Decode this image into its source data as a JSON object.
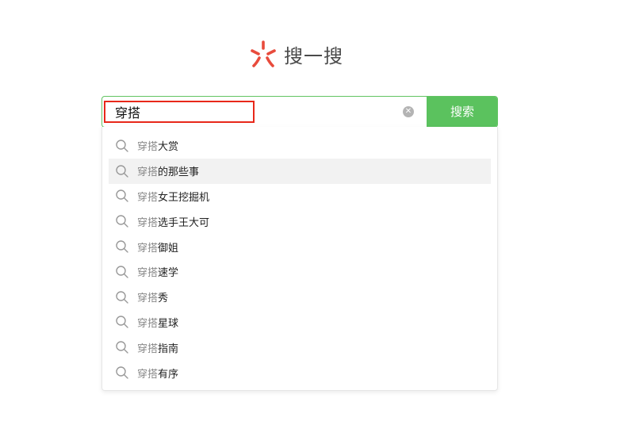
{
  "brand": {
    "title": "搜一搜",
    "logo_icon": "sousou-logo-icon",
    "logo_color": "#e84b3c"
  },
  "search": {
    "query": "穿搭",
    "placeholder": "",
    "clear_icon": "clear-icon",
    "button_label": "搜索",
    "accent_color": "#5bc25e"
  },
  "suggestions": {
    "prefix": "穿搭",
    "active_index": 1,
    "items": [
      {
        "rest": "大赏"
      },
      {
        "rest": "的那些事"
      },
      {
        "rest": "女王挖掘机"
      },
      {
        "rest": "选手王大可"
      },
      {
        "rest": "御姐"
      },
      {
        "rest": "速学"
      },
      {
        "rest": "秀"
      },
      {
        "rest": "星球"
      },
      {
        "rest": "指南"
      },
      {
        "rest": "有序"
      }
    ]
  }
}
